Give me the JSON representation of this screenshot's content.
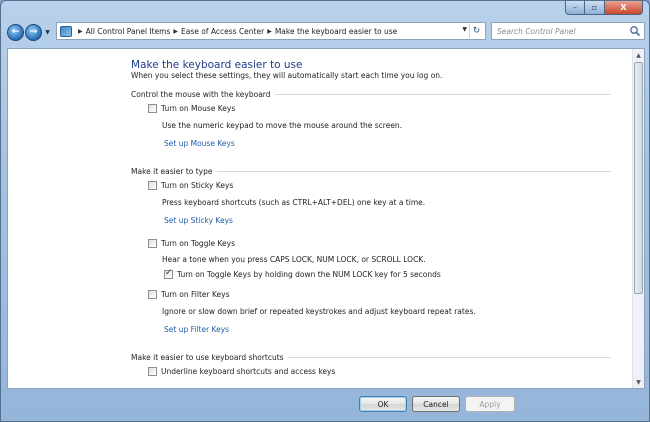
{
  "window": {
    "caption_buttons": {
      "minimize": "–",
      "maximize": "▫",
      "close": "X"
    }
  },
  "nav": {
    "back": "←",
    "forward": "→",
    "breadcrumbs": [
      "All Control Panel Items",
      "Ease of Access Center",
      "Make the keyboard easier to use"
    ],
    "search_placeholder": "Search Control Panel"
  },
  "page": {
    "title": "Make the keyboard easier to use",
    "description": "When you select these settings, they will automatically start each time you log on."
  },
  "sections": {
    "mouse": {
      "label": "Control the mouse with the keyboard",
      "mouse_keys": {
        "label": "Turn on Mouse Keys",
        "checked": false
      },
      "mouse_keys_desc": "Use the numeric keypad to move the mouse around the screen.",
      "mouse_keys_link": "Set up Mouse Keys"
    },
    "typing": {
      "label": "Make it easier to type",
      "sticky_keys": {
        "label": "Turn on Sticky Keys",
        "checked": false
      },
      "sticky_keys_desc": "Press keyboard shortcuts (such as CTRL+ALT+DEL) one key at a time.",
      "sticky_keys_link": "Set up Sticky Keys",
      "toggle_keys": {
        "label": "Turn on Toggle Keys",
        "checked": false
      },
      "toggle_keys_desc": "Hear a tone when you press CAPS LOCK, NUM LOCK, or SCROLL LOCK.",
      "toggle_keys_hold": {
        "label": "Turn on Toggle Keys by holding down the NUM LOCK key for 5 seconds",
        "checked": true
      },
      "filter_keys": {
        "label": "Turn on Filter Keys",
        "checked": false
      },
      "filter_keys_desc": "Ignore or slow down brief or repeated keystrokes and adjust keyboard repeat rates.",
      "filter_keys_link": "Set up Filter Keys"
    },
    "shortcuts": {
      "label": "Make it easier to use keyboard shortcuts",
      "underline": {
        "label": "Underline keyboard shortcuts and access keys",
        "checked": false
      }
    }
  },
  "footer": {
    "ok": "OK",
    "cancel": "Cancel",
    "apply": "Apply"
  }
}
